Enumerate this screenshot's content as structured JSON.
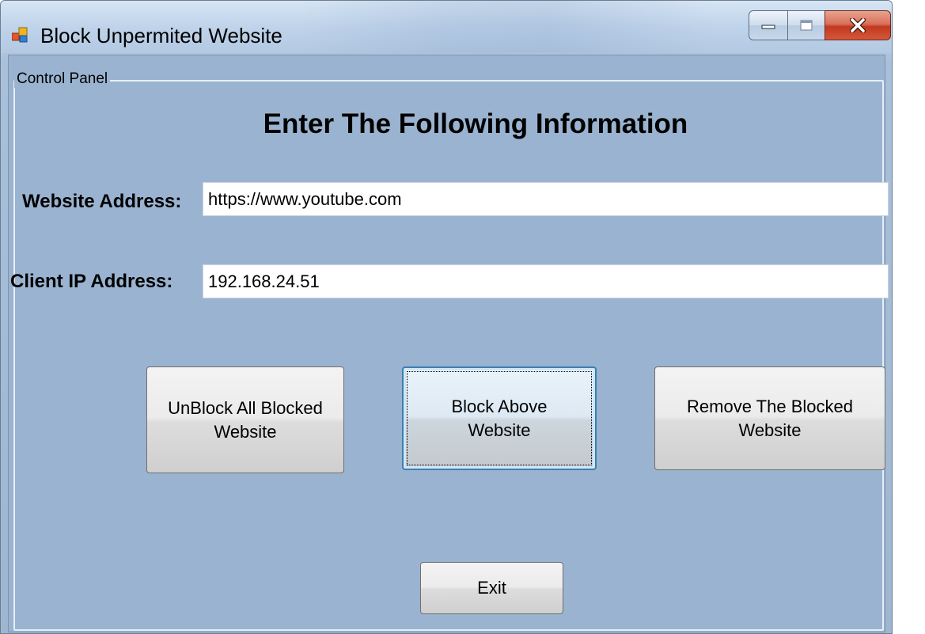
{
  "window": {
    "title": "Block Unpermited Website"
  },
  "titlebar": {
    "buttons": [
      "minimize",
      "maximize",
      "close"
    ]
  },
  "groupbox": {
    "label": "Control Panel"
  },
  "form": {
    "heading": "Enter The Following Information",
    "website_label": "Website Address:",
    "website_value": "https://www.youtube.com",
    "ip_label": "Client IP Address:",
    "ip_value": "192.168.24.51"
  },
  "buttons": {
    "unblock_line1": "UnBlock All Blocked",
    "unblock_line2": "Website",
    "block_line1": "Block Above",
    "block_line2": "Website",
    "remove_line1": "Remove The Blocked",
    "remove_line2": "Website",
    "exit": "Exit"
  },
  "icons": {
    "app": "app-window-icon",
    "minimize": "minimize-icon",
    "maximize": "maximize-icon",
    "close": "close-icon"
  },
  "colors": {
    "form_background": "#9ab3d0",
    "close_button": "#c2391f",
    "focus_border": "#3c7fb1"
  }
}
